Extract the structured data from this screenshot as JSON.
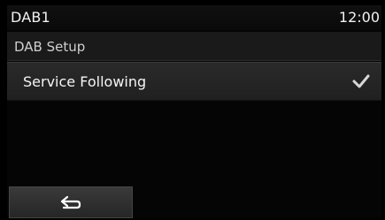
{
  "status_bar": {
    "source": "DAB1",
    "time": "12:00"
  },
  "menu": {
    "title": "DAB Setup",
    "items": [
      {
        "label": "Service Following",
        "checked": true,
        "icon": "checkmark-icon"
      }
    ]
  },
  "footer": {
    "back_button_icon": "back-arrow-icon"
  }
}
